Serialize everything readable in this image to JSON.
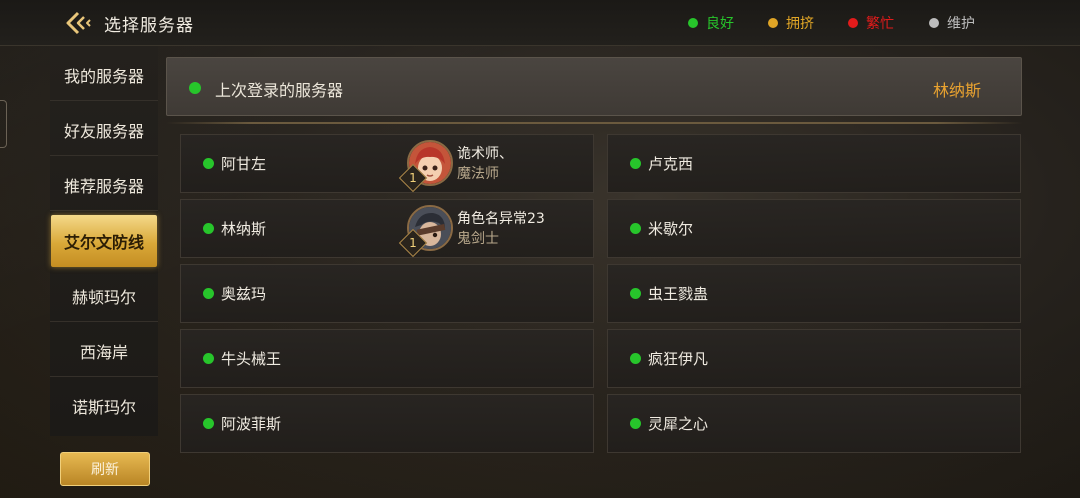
{
  "header": {
    "title": "选择服务器",
    "legend": [
      {
        "label": "良好",
        "color": "#27c52b"
      },
      {
        "label": "拥挤",
        "color": "#e0a526"
      },
      {
        "label": "繁忙",
        "color": "#e31b1b"
      },
      {
        "label": "维护",
        "color": "#bdbdbd"
      }
    ]
  },
  "sidebar": {
    "items": [
      {
        "label": "我的服务器"
      },
      {
        "label": "好友服务器"
      },
      {
        "label": "推荐服务器"
      },
      {
        "label": "艾尔文防线",
        "active": true
      },
      {
        "label": "赫顿玛尔"
      },
      {
        "label": "西海岸"
      },
      {
        "label": "诺斯玛尔"
      }
    ],
    "refresh_label": "刷新"
  },
  "last_login": {
    "label": "上次登录的服务器",
    "server": "林纳斯"
  },
  "servers": {
    "left": [
      {
        "name": "阿甘左",
        "status": "good",
        "character": {
          "name": "诡术师、",
          "job": "魔法师",
          "level": "1"
        }
      },
      {
        "name": "林纳斯",
        "status": "good",
        "character": {
          "name": "角色名异常23",
          "job": "鬼剑士",
          "level": "1"
        }
      },
      {
        "name": "奥兹玛",
        "status": "good"
      },
      {
        "name": "牛头械王",
        "status": "good"
      },
      {
        "name": "阿波菲斯",
        "status": "good"
      }
    ],
    "right": [
      {
        "name": "卢克西",
        "status": "good"
      },
      {
        "name": "米歇尔",
        "status": "good"
      },
      {
        "name": "虫王戮蛊",
        "status": "good"
      },
      {
        "name": "疯狂伊凡",
        "status": "good"
      },
      {
        "name": "灵犀之心",
        "status": "good"
      }
    ]
  }
}
